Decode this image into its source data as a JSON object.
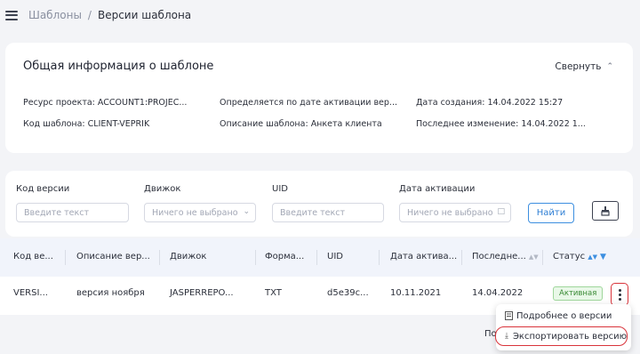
{
  "breadcrumb": {
    "parent": "Шаблоны",
    "separator": "/",
    "current": "Версии шаблона"
  },
  "info": {
    "title": "Общая информация о шаблоне",
    "collapse_label": "Свернуть",
    "items": [
      {
        "label": "Ресурс проекта:",
        "value": "ACCOUNT1:PROJEC..."
      },
      {
        "label": "Определяется по дате активации вер...",
        "value": ""
      },
      {
        "label": "Дата создания:",
        "value": "14.04.2022 15:27"
      },
      {
        "label": "Код шаблона:",
        "value": "CLIENT-VEPRIK"
      },
      {
        "label": "Описание шаблона:",
        "value": "Анкета клиента"
      },
      {
        "label": "Последнее изменение:",
        "value": "14.04.2022 1..."
      }
    ]
  },
  "filters": {
    "version_code": {
      "label": "Код версии",
      "placeholder": "Введите текст"
    },
    "engine": {
      "label": "Движок",
      "placeholder": "Ничего не выбрано"
    },
    "uid": {
      "label": "UID",
      "placeholder": "Введите текст"
    },
    "activation_date": {
      "label": "Дата активации",
      "placeholder": "Ничего не выбрано"
    },
    "find_label": "Найти"
  },
  "table": {
    "headers": [
      "Код ве...",
      "Описание вер...",
      "Движок",
      "Форма...",
      "UID",
      "Дата актива...",
      "Последне...",
      "Статус"
    ],
    "rows": [
      {
        "code": "VERSI...",
        "description": "версия ноября",
        "engine": "JASPERREPO...",
        "format": "TXT",
        "uid": "d5e39c...",
        "activation": "10.11.2021",
        "last": "14.04.2022",
        "status": "Активная"
      }
    ]
  },
  "partial_text": "По",
  "dropdown": {
    "items": [
      {
        "label": "Подробнее о версии",
        "icon": "document-icon"
      },
      {
        "label": "Экспортировать версию",
        "icon": "download-icon"
      }
    ]
  }
}
